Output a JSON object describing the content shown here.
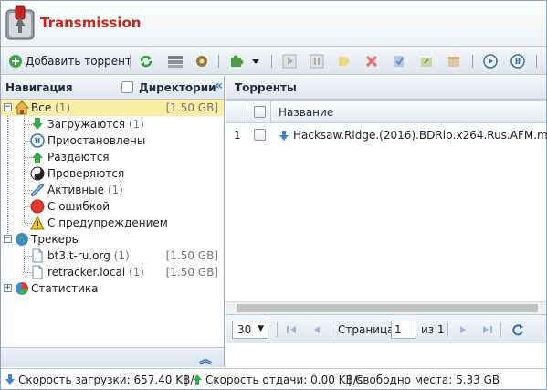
{
  "app": {
    "title": "Transmission"
  },
  "toolbar": {
    "add_label": "Добавить торрент"
  },
  "left": {
    "nav_title": "Навигация",
    "dirs_label": "Директории",
    "tree": {
      "all": {
        "label": "Все",
        "count": "(1)",
        "size": "[1.50 GB]"
      },
      "downloading": {
        "label": "Загружаются",
        "count": "(1)"
      },
      "paused": {
        "label": "Приостановлены"
      },
      "seeding": {
        "label": "Раздаются"
      },
      "checking": {
        "label": "Проверяются"
      },
      "active": {
        "label": "Активные",
        "count": "(1)"
      },
      "error": {
        "label": "С ошибкой"
      },
      "warning": {
        "label": "С предупреждением"
      },
      "trackers": {
        "label": "Трекеры"
      },
      "tracker1": {
        "label": "bt3.t-ru.org",
        "count": "(1)",
        "size": "[1.50 GB]"
      },
      "tracker2": {
        "label": "retracker.local",
        "count": "(1)",
        "size": "[1.50 GB]"
      },
      "stats": {
        "label": "Статистика"
      }
    }
  },
  "right": {
    "title": "Торренты",
    "column_name": "Название",
    "rows": [
      {
        "num": "1",
        "name": "Hacksaw.Ridge.(2016).BDRip.x264.Rus.AFM.mkv"
      }
    ],
    "pager": {
      "page_size": "30",
      "page_label": "Страница",
      "page_value": "1",
      "of_label": "из 1"
    }
  },
  "status": {
    "download": "Скорость загрузки: 657.40 KB/s",
    "upload": "Скорость отдачи: 0.00 KB/s",
    "free": "Свободно места: 5.33 GB"
  },
  "colors": {
    "accent": "#c0261e",
    "selection": "#fbeda4",
    "link": "#3a6fb6"
  }
}
